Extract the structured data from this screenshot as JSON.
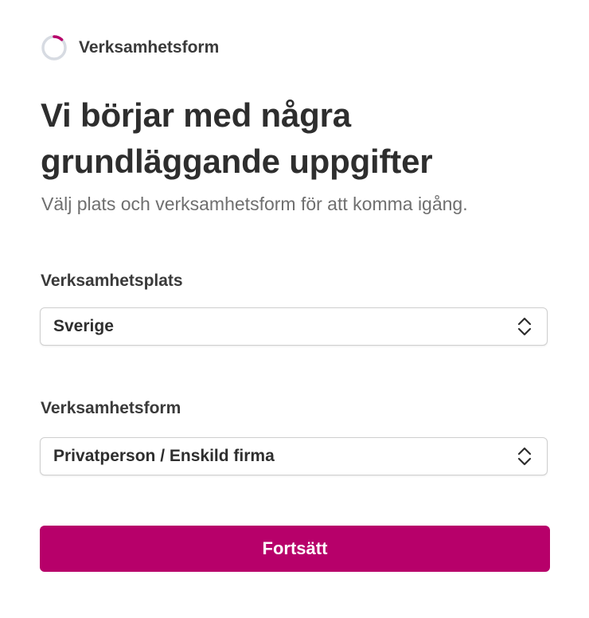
{
  "header": {
    "step_label": "Verksamhetsform",
    "progress": 0.12,
    "progress_color": "#b7006a",
    "progress_track_color": "#d7dbe2"
  },
  "main": {
    "title": "Vi börjar med några grundläggande uppgifter",
    "subtitle": "Välj plats och verksamhetsform för att komma igång."
  },
  "fields": {
    "location": {
      "label": "Verksamhetsplats",
      "value": "Sverige"
    },
    "business_form": {
      "label": "Verksamhetsform",
      "value": "Privatperson / Enskild firma"
    }
  },
  "actions": {
    "continue_label": "Fortsätt"
  },
  "icons": {
    "step_progress": "progress-ring-icon",
    "select_indicator": "chevron-up-down-icon"
  },
  "colors": {
    "accent": "#b7006a"
  }
}
